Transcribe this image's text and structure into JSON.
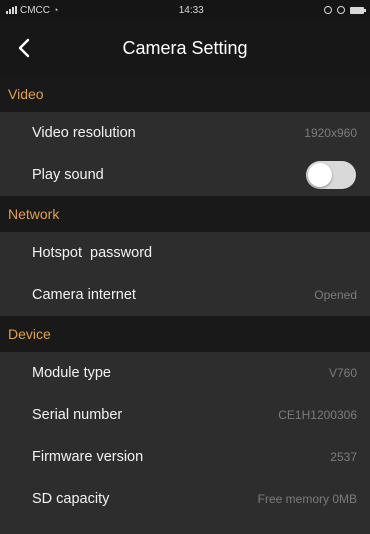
{
  "status_bar": {
    "carrier": "CMCC",
    "time": "14:33"
  },
  "header": {
    "title": "Camera Setting"
  },
  "sections": {
    "video": {
      "label": "Video",
      "video_resolution": {
        "label": "Video resolution",
        "value": "1920x960"
      },
      "play_sound": {
        "label": "Play sound",
        "toggle_on": false
      }
    },
    "network": {
      "label": "Network",
      "hotspot_password": {
        "label": "Hotspot  password",
        "value": ""
      },
      "camera_internet": {
        "label": "Camera internet",
        "value": "Opened"
      }
    },
    "device": {
      "label": "Device",
      "module_type": {
        "label": "Module type",
        "value": "V760"
      },
      "serial_number": {
        "label": "Serial number",
        "value": "CE1H1200306"
      },
      "firmware_version": {
        "label": "Firmware version",
        "value": "2537"
      },
      "sd_capacity": {
        "label": "SD capacity",
        "value": "Free memory 0MB"
      }
    }
  },
  "colors": {
    "section_header_text": "#e0a050",
    "background": "#2d2d2d",
    "header_background": "#171717"
  },
  "icons": {
    "signal": "signal-icon",
    "wifi": "wifi-icon",
    "alarm": "alarm-icon",
    "battery": "battery-icon",
    "back": "back-arrow-icon"
  }
}
